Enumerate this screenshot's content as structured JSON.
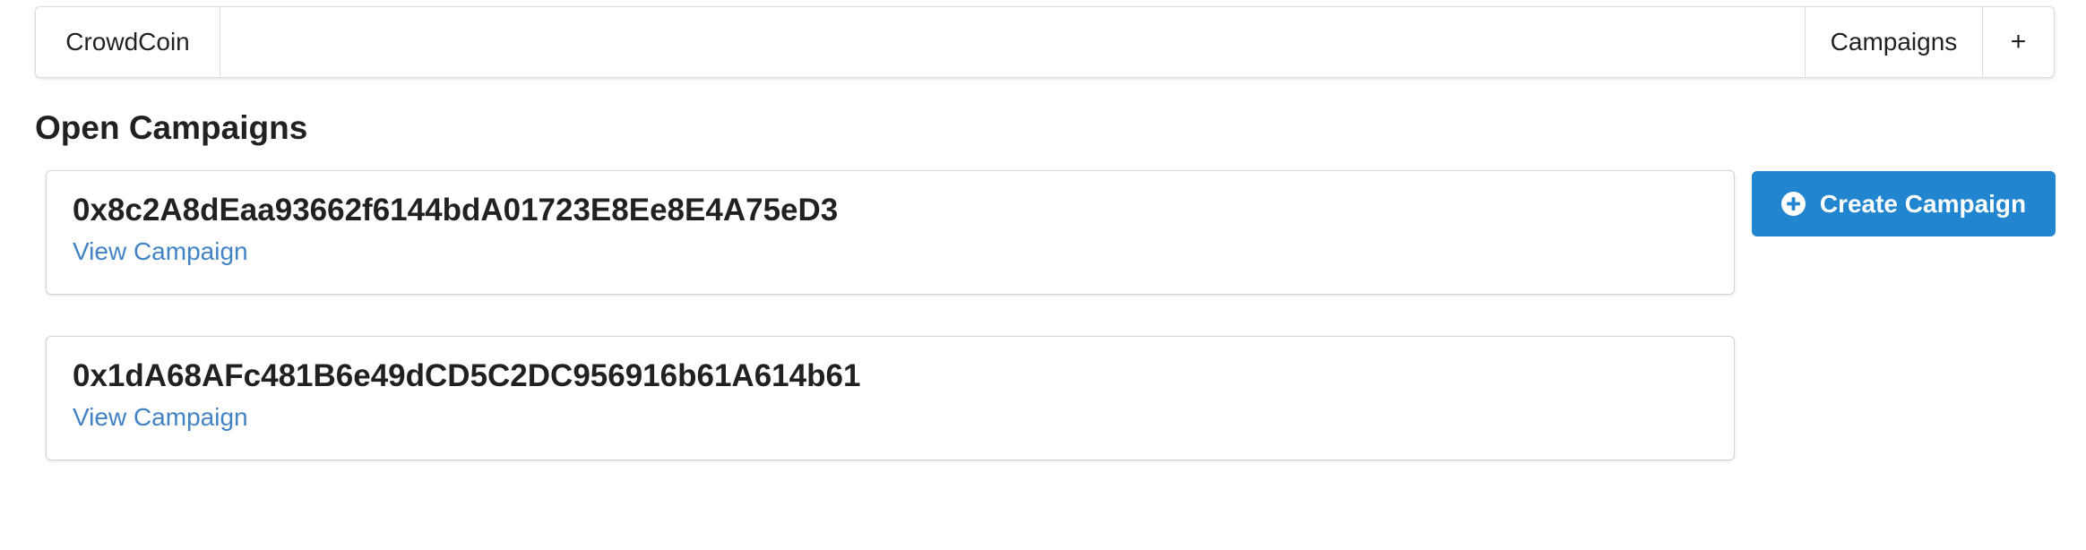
{
  "menu": {
    "brand": "CrowdCoin",
    "campaigns_label": "Campaigns",
    "add_label": "+"
  },
  "main": {
    "heading": "Open Campaigns",
    "campaigns": [
      {
        "address": "0x8c2A8dEaa93662f6144bdA01723E8Ee8E4A75eD3",
        "link_label": "View Campaign"
      },
      {
        "address": "0x1dA68AFc481B6e49dCD5C2DC956916b61A614b61",
        "link_label": "View Campaign"
      }
    ],
    "create_button": {
      "label": "Create Campaign",
      "icon": "plus-circle-icon"
    }
  },
  "colors": {
    "primary": "#2185d0",
    "link": "#4183c4"
  }
}
